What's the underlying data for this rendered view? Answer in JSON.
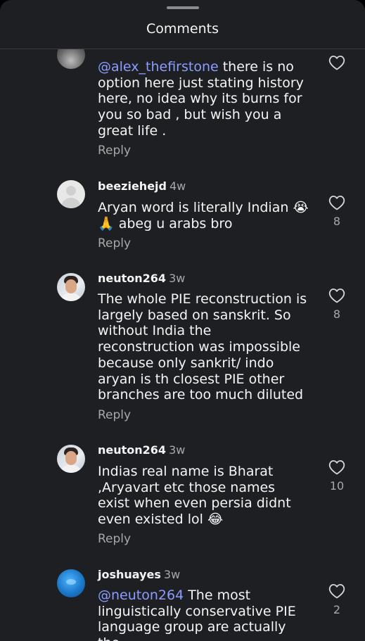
{
  "header": {
    "title": "Comments"
  },
  "comments": [
    {
      "username": "",
      "time": "",
      "mention": "@alex_thefirstone",
      "text": "  there is no option here just stating history here, no idea why its burns for you so bad , but wish you a great life .",
      "reply": "Reply",
      "likes": ""
    },
    {
      "username": "beeziehejd",
      "time": "4w",
      "mention": "",
      "text": "Aryan word is literally Indian 😭\n🙏 abeg u arabs bro",
      "reply": "Reply",
      "likes": "8"
    },
    {
      "username": "neuton264",
      "time": "3w",
      "mention": "",
      "text": "The whole PIE reconstruction is largely based on sanskrit.  So without India the reconstruction was impossible because only sankrit/ indo aryan is th closest PIE other branches are too much diluted",
      "reply": "Reply",
      "likes": "8"
    },
    {
      "username": "neuton264",
      "time": "3w",
      "mention": "",
      "text": "Indias real name is Bharat ,Aryavart etc those names exist when even persia didnt even existed lol 😂",
      "reply": "Reply",
      "likes": "10"
    },
    {
      "username": "joshuayes",
      "time": "3w",
      "mention": "@neuton264",
      "text": " The most linguistically conservative PIE language group are actually the",
      "reply": "",
      "likes": "2"
    }
  ]
}
